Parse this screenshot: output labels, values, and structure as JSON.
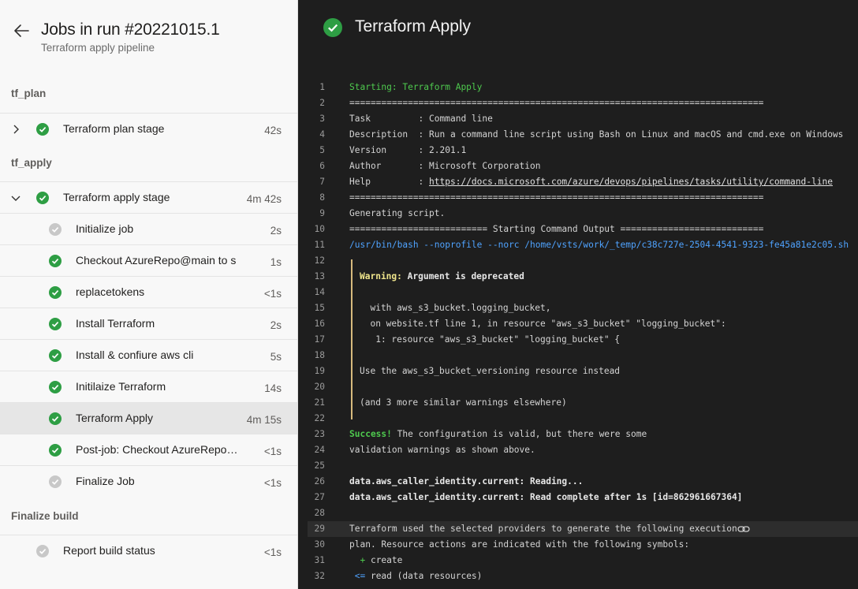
{
  "header": {
    "title": "Jobs in run #20221015.1",
    "subtitle": "Terraform apply pipeline"
  },
  "groups": {
    "tf_plan": "tf_plan",
    "tf_apply": "tf_apply",
    "finalize": "Finalize build"
  },
  "stages": {
    "plan": {
      "label": "Terraform plan stage",
      "duration": "42s",
      "status": "success"
    },
    "apply": {
      "label": "Terraform apply stage",
      "duration": "4m 42s",
      "status": "success"
    }
  },
  "jobs": [
    {
      "label": "Initialize job",
      "duration": "2s",
      "status": "neutral"
    },
    {
      "label": "Checkout AzureRepo@main to s",
      "duration": "1s",
      "status": "success"
    },
    {
      "label": "replacetokens",
      "duration": "<1s",
      "status": "success"
    },
    {
      "label": "Install Terraform",
      "duration": "2s",
      "status": "success"
    },
    {
      "label": "Install & confiure aws cli",
      "duration": "5s",
      "status": "success"
    },
    {
      "label": "Initilaize Terraform",
      "duration": "14s",
      "status": "success"
    },
    {
      "label": "Terraform Apply",
      "duration": "4m 15s",
      "status": "success",
      "selected": true
    },
    {
      "label": "Post-job: Checkout AzureRepo@...",
      "duration": "<1s",
      "status": "success"
    },
    {
      "label": "Finalize Job",
      "duration": "<1s",
      "status": "neutral"
    }
  ],
  "finalize": {
    "label": "Report build status",
    "duration": "<1s",
    "status": "neutral"
  },
  "log": {
    "title": "Terraform Apply",
    "lines": {
      "l1": "Starting: Terraform Apply",
      "l2": "==============================================================================",
      "l3": "Task         : Command line",
      "l4": "Description  : Run a command line script using Bash on Linux and macOS and cmd.exe on Windows",
      "l5": "Version      : 2.201.1",
      "l6": "Author       : Microsoft Corporation",
      "l7_prefix": "Help         : ",
      "l7_link": "https://docs.microsoft.com/azure/devops/pipelines/tasks/utility/command-line",
      "l8": "==============================================================================",
      "l9": "Generating script.",
      "l10": "========================== Starting Command Output ===========================",
      "l11": "/usr/bin/bash --noprofile --norc /home/vsts/work/_temp/c38c727e-2504-4541-9323-fe45a81e2c05.sh",
      "l13_warn": "Warning:",
      "l13_rest": " Argument is deprecated",
      "l15": "  with aws_s3_bucket.logging_bucket,",
      "l16": "  on website.tf line 1, in resource \"aws_s3_bucket\" \"logging_bucket\":",
      "l17": "   1: resource \"aws_s3_bucket\" \"logging_bucket\" {",
      "l19": "Use the aws_s3_bucket_versioning resource instead",
      "l21": "(and 3 more similar warnings elsewhere)",
      "l23_success": "Success!",
      "l23_rest": " The configuration is valid, but there were some",
      "l24": "validation warnings as shown above.",
      "l26": "data.aws_caller_identity.current: Reading...",
      "l27": "data.aws_caller_identity.current: Read complete after 1s [id=862961667364]",
      "l29": "Terraform used the selected providers to generate the following execution",
      "l30": "plan. Resource actions are indicated with the following symbols:",
      "l31_sym": "  + ",
      "l31_rest": "create",
      "l32_sym": " <= ",
      "l32_rest": "read (data resources)"
    },
    "numbers": [
      "1",
      "2",
      "3",
      "4",
      "5",
      "6",
      "7",
      "8",
      "9",
      "10",
      "11",
      "12",
      "13",
      "14",
      "15",
      "16",
      "17",
      "18",
      "19",
      "20",
      "21",
      "22",
      "23",
      "24",
      "25",
      "26",
      "27",
      "28",
      "29",
      "30",
      "31",
      "32"
    ]
  },
  "colors": {
    "success": "#2e9e44",
    "neutral": "#c8c8c8",
    "log_bg": "#1e1e1e",
    "log_green": "#4ec94e",
    "log_yellow": "#f0e68c"
  }
}
